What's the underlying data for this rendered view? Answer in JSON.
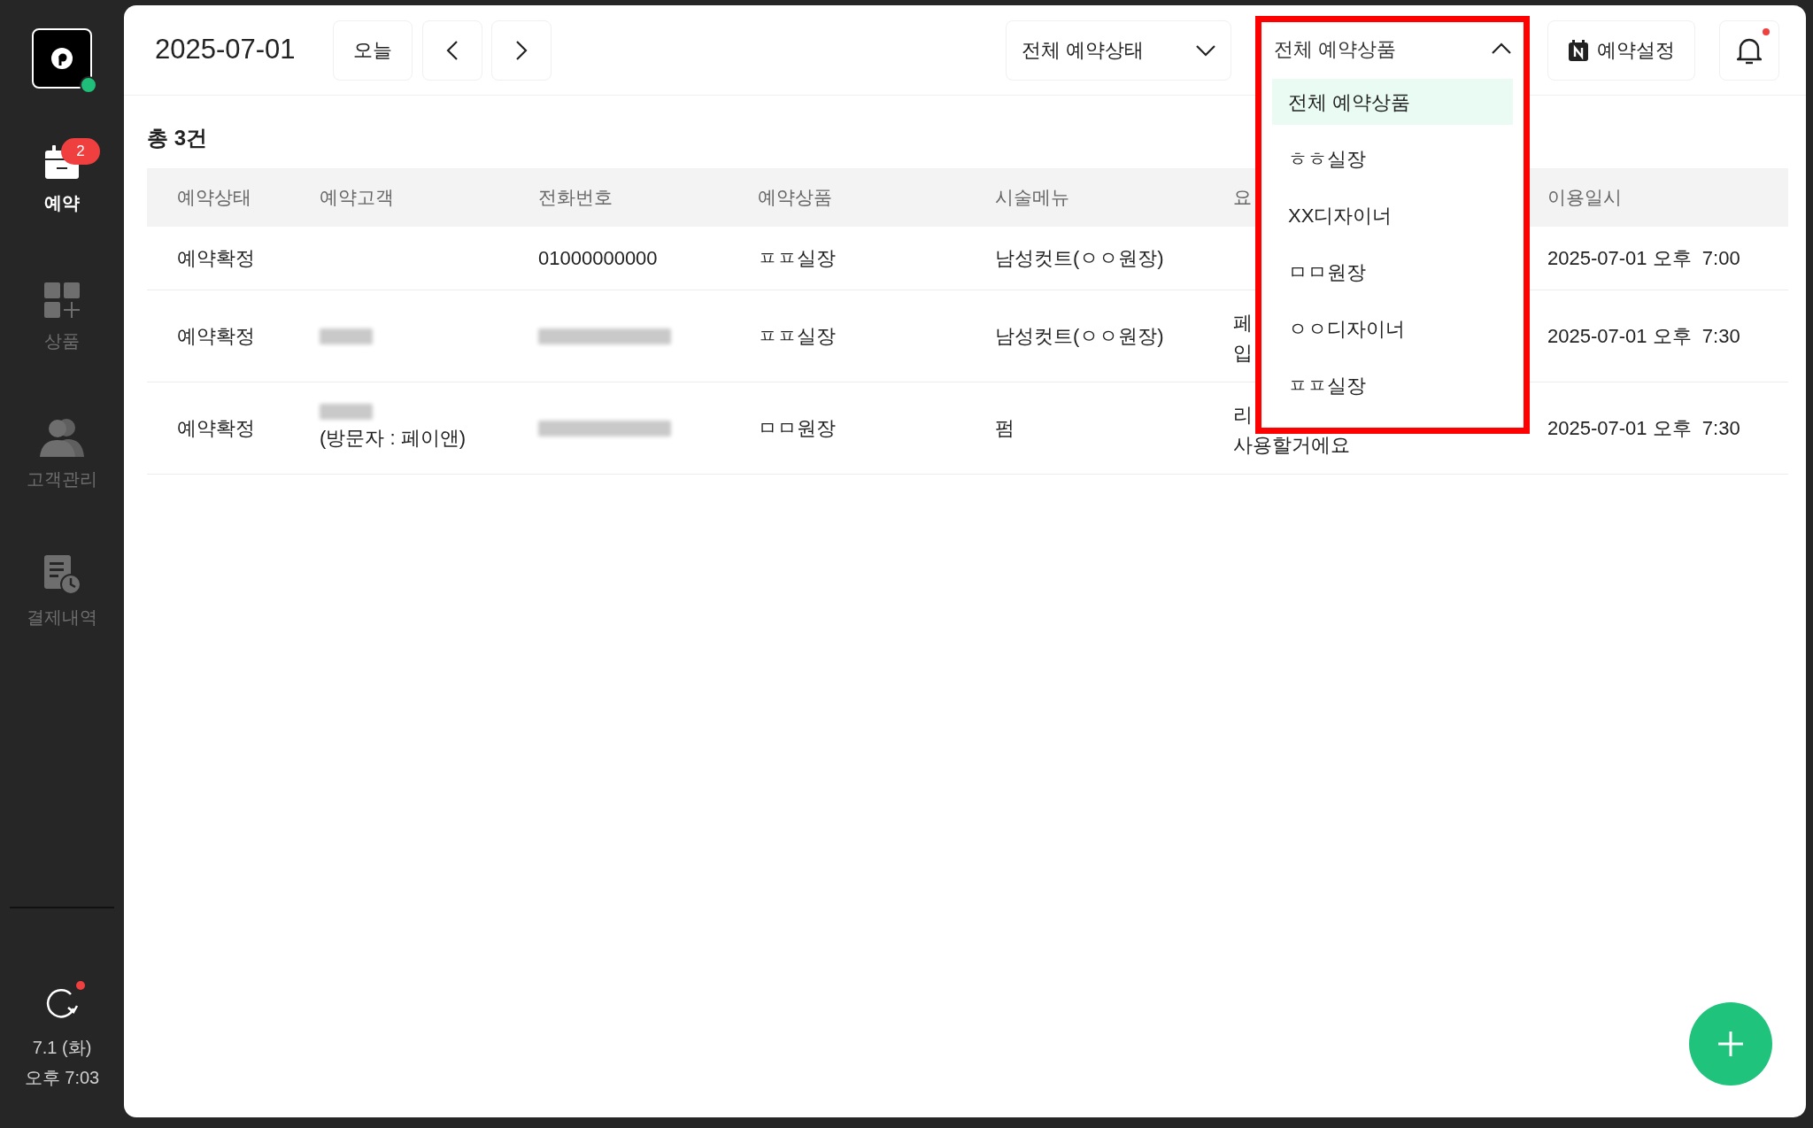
{
  "sidebar": {
    "online": true,
    "items": [
      {
        "kind": "calendar",
        "label": "예약",
        "selected": true,
        "badge": "2"
      },
      {
        "kind": "grid",
        "label": "상품",
        "selected": false
      },
      {
        "kind": "users",
        "label": "고객관리",
        "selected": false
      },
      {
        "kind": "receipt",
        "label": "결제내역",
        "selected": false
      }
    ],
    "refresh": {
      "has_update": true
    },
    "date": "7.1 (화)",
    "time": "오후 7:03"
  },
  "toolbar": {
    "date": "2025-07-01",
    "today_button": "오늘",
    "status_filter": {
      "value": "전체 예약상태",
      "expanded": false
    },
    "product_filter": {
      "value": "전체 예약상품",
      "expanded": true,
      "options": [
        {
          "label": "전체 예약상품",
          "selected": true
        },
        {
          "label": "ㅎㅎ실장",
          "selected": false
        },
        {
          "label": "XX디자이너",
          "selected": false
        },
        {
          "label": "ㅁㅁ원장",
          "selected": false
        },
        {
          "label": "ㅇㅇ디자이너",
          "selected": false
        },
        {
          "label": "ㅍㅍ실장",
          "selected": false
        }
      ]
    },
    "settings_button": "예약설정",
    "notifications": {
      "unread": true
    }
  },
  "summary": "총 3건",
  "table": {
    "columns": [
      "예약상태",
      "예약고객",
      "전화번호",
      "예약상품",
      "시술메뉴",
      "요",
      "이용일시"
    ],
    "rows": [
      {
        "status": "예약확정",
        "phone": {
          "text": "01000000000",
          "blurred": false
        },
        "product": "ㅍㅍ실장",
        "menu": "남성컷트(ㅇㅇ원장)",
        "datetime": "2025-07-01 오후  7:00"
      },
      {
        "status": "예약확정",
        "customer": {
          "blurred": true
        },
        "phone": {
          "blurred": true
        },
        "product": "ㅍㅍ실장",
        "menu": "남성컷트(ㅇㅇ원장)",
        "request": [
          "페",
          "입"
        ],
        "datetime": "2025-07-01 오후  7:30"
      },
      {
        "status": "예약확정",
        "customer": {
          "blurred": true,
          "note": "(방문자 : 페이앤)"
        },
        "phone": {
          "blurred": true
        },
        "product": "ㅁㅁ원장",
        "menu": "펌",
        "request": [
          "리",
          "사용할거에요"
        ],
        "datetime": "2025-07-01 오후  7:30"
      }
    ]
  },
  "add_button": {
    "kind": "fab"
  }
}
